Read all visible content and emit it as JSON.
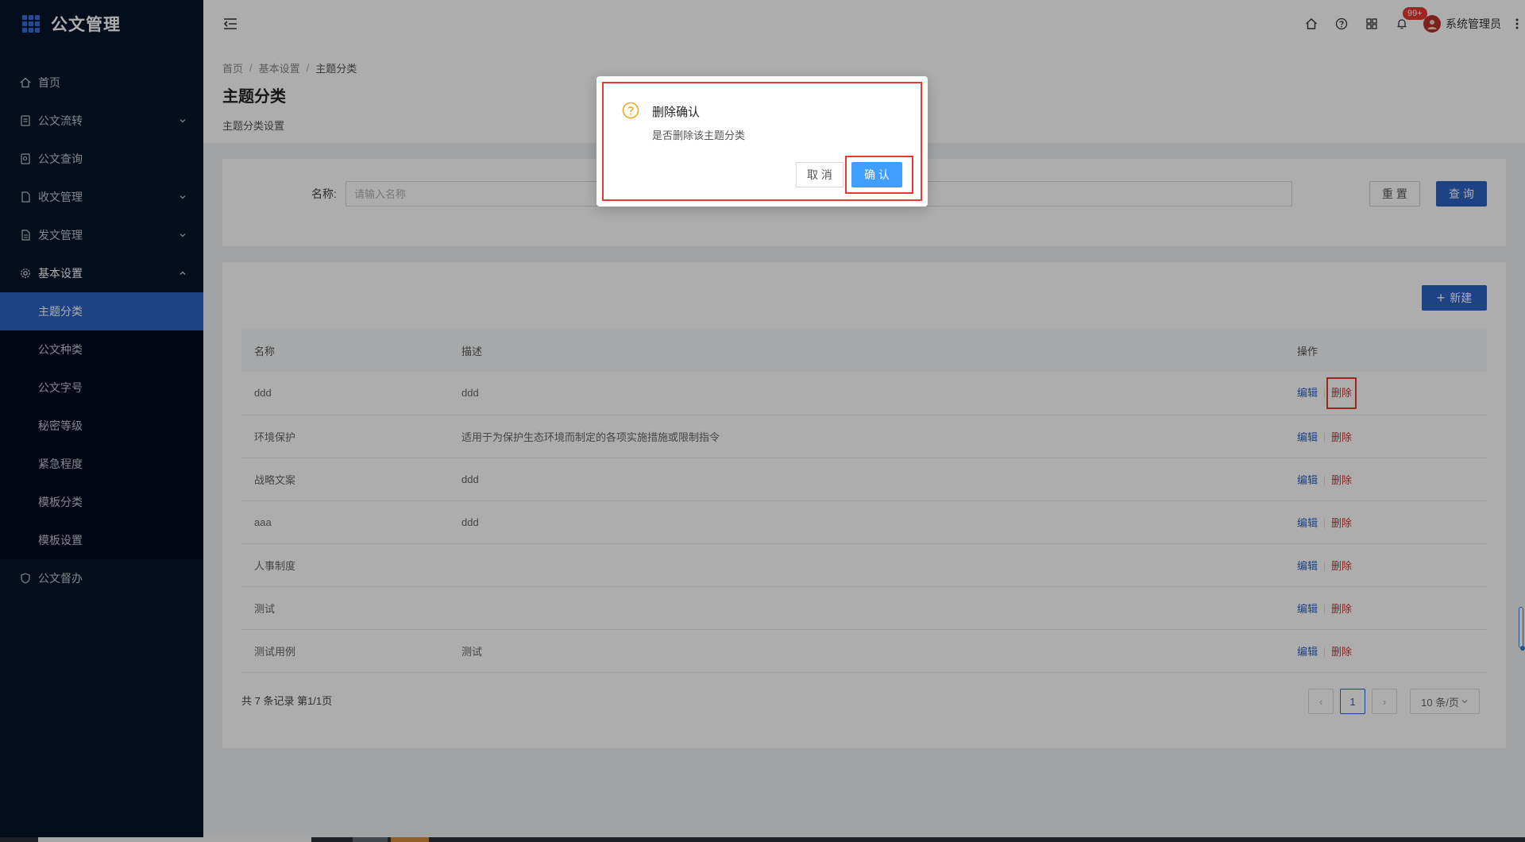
{
  "app": {
    "title": "公文管理"
  },
  "sidebar": {
    "items": [
      {
        "label": "首页"
      },
      {
        "label": "公文流转"
      },
      {
        "label": "公文查询"
      },
      {
        "label": "收文管理"
      },
      {
        "label": "发文管理"
      },
      {
        "label": "基本设置"
      },
      {
        "label": "公文督办"
      }
    ],
    "sub_items": [
      {
        "label": "主题分类"
      },
      {
        "label": "公文种类"
      },
      {
        "label": "公文字号"
      },
      {
        "label": "秘密等级"
      },
      {
        "label": "紧急程度"
      },
      {
        "label": "模板分类"
      },
      {
        "label": "模板设置"
      }
    ]
  },
  "header": {
    "notification_badge": "99+",
    "username": "系统管理员"
  },
  "breadcrumb": [
    "首页",
    "基本设置",
    "主题分类"
  ],
  "page": {
    "title": "主题分类",
    "subtitle": "主题分类设置"
  },
  "search": {
    "label": "名称:",
    "placeholder": "请输入名称",
    "reset_label": "重 置",
    "query_label": "查 询"
  },
  "toolbar": {
    "new_label": "新建"
  },
  "table": {
    "columns": [
      "名称",
      "描述",
      "操作"
    ],
    "rows": [
      {
        "name": "ddd",
        "desc": "ddd"
      },
      {
        "name": "环境保护",
        "desc": "适用于为保护生态环境而制定的各项实施措施或限制指令"
      },
      {
        "name": "战略文案",
        "desc": "ddd"
      },
      {
        "name": "aaa",
        "desc": "ddd"
      },
      {
        "name": "人事制度",
        "desc": ""
      },
      {
        "name": "测试",
        "desc": ""
      },
      {
        "name": "测试用例",
        "desc": "测试"
      }
    ],
    "edit_label": "编辑",
    "delete_label": "删除"
  },
  "pagination": {
    "summary": "共 7 条记录 第1/1页",
    "current_page": "1",
    "prev": "‹",
    "next": "›",
    "page_size": "10 条/页"
  },
  "dialog": {
    "title": "删除确认",
    "content": "是否删除该主题分类",
    "cancel_label": "取 消",
    "confirm_label": "确 认"
  },
  "colors": {
    "sidebar_bg": "#06142a",
    "primary": "#2b63c3",
    "danger": "#d9302e",
    "highlight": "#e53935",
    "confirm": "#409eff"
  }
}
